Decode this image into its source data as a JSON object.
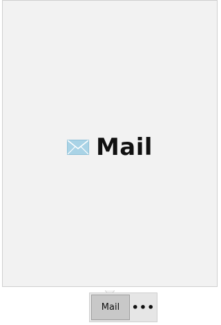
{
  "preview": {
    "app_name": "Mail",
    "icon": "mail-envelope-icon"
  },
  "taskbar": {
    "button_label": "Mail",
    "more_label": "•••"
  },
  "colors": {
    "panel_bg": "#f2f2f2",
    "panel_border": "#cfcfcf",
    "button_bg": "#c8c8c8",
    "icon_fill": "#a9d3e6"
  }
}
